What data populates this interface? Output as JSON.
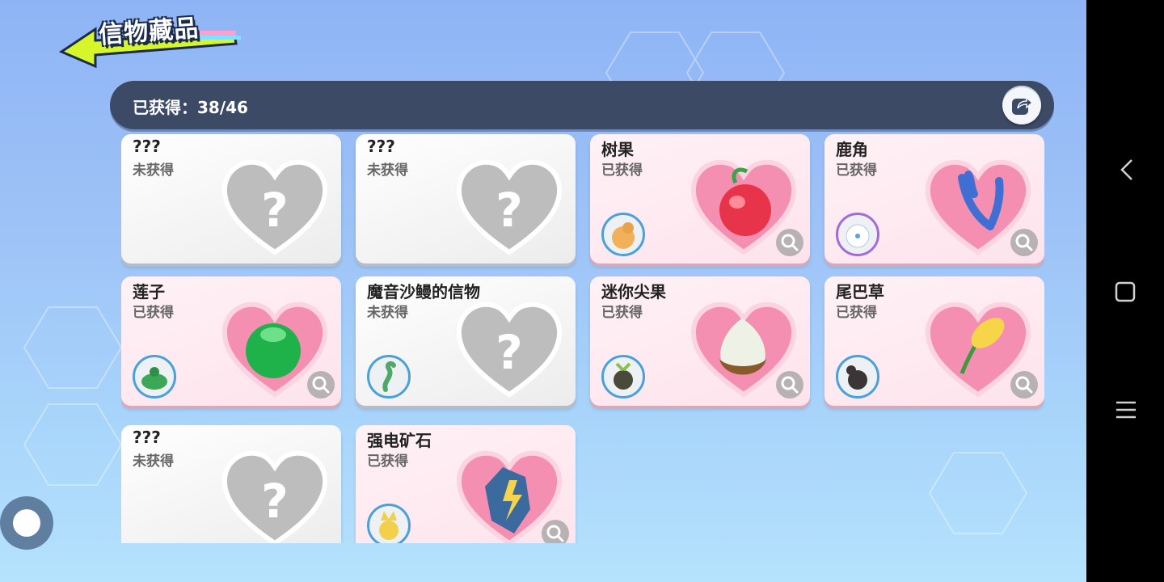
{
  "header": {
    "title": "信物藏品",
    "obtained_label": "已获得：38/46"
  },
  "colors": {
    "accent_arrow": "#d6f52a",
    "header_bar": "#3c4a66",
    "heart_pink": "#f58fb2",
    "heart_gray": "#b9b9b9",
    "avatar_ring": "#4aa0d8"
  },
  "cards": [
    {
      "name": "???",
      "status": "未获得",
      "obtained": false
    },
    {
      "name": "???",
      "status": "未获得",
      "obtained": false
    },
    {
      "name": "树果",
      "status": "已获得",
      "obtained": true
    },
    {
      "name": "鹿角",
      "status": "已获得",
      "obtained": true
    },
    {
      "name": "莲子",
      "status": "已获得",
      "obtained": true
    },
    {
      "name": "魔音沙鳗的信物",
      "status": "未获得",
      "obtained": false
    },
    {
      "name": "迷你尖果",
      "status": "已获得",
      "obtained": true
    },
    {
      "name": "尾巴草",
      "status": "已获得",
      "obtained": true
    },
    {
      "name": "???",
      "status": "未获得",
      "obtained": false
    },
    {
      "name": "强电矿石",
      "status": "已获得",
      "obtained": true
    }
  ],
  "icons": {
    "share": "share-icon",
    "magnify": "magnify-icon",
    "back": "back-arrow-icon"
  }
}
